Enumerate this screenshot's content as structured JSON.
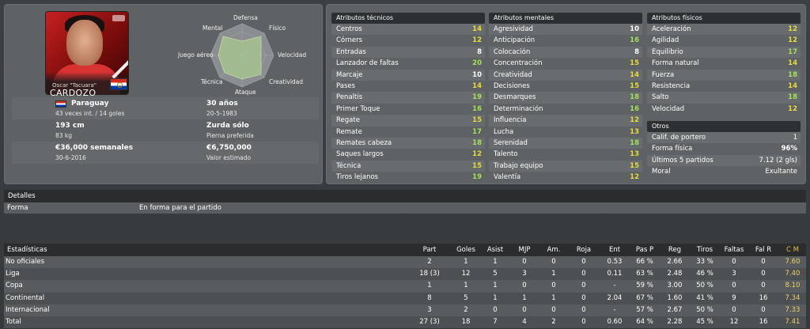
{
  "player": {
    "nickname": "Oscar \"Tacuara\"",
    "surname": "CARDOZO",
    "nationality": "Paraguay",
    "caps": "43 veces int. / 14 goles",
    "age": "30 años",
    "dob": "20-5-1983",
    "height": "193 cm",
    "weight": "83 kg",
    "foot": "Zurda sólo",
    "foot_sub": "Pierna preferida",
    "wage": "€36,000 semanales",
    "contract_end": "30-6-2016",
    "value": "€6,750,000",
    "value_sub": "Valor estimado",
    "flag_colors": [
      "#d52b1e",
      "#ffffff",
      "#0038a8"
    ]
  },
  "radar": {
    "labels": [
      "Defensa",
      "Físico",
      "Velocidad",
      "Creatividad",
      "Ataque",
      "Técnica",
      "Juego aéreo",
      "Mental"
    ]
  },
  "technical": {
    "title": "Atributos técnicos",
    "rows": [
      {
        "name": "Centros",
        "value": "14",
        "color": "yellow"
      },
      {
        "name": "Córners",
        "value": "12",
        "color": "yellow"
      },
      {
        "name": "Entradas",
        "value": "8",
        "color": "white"
      },
      {
        "name": "Lanzador de faltas",
        "value": "20",
        "color": "green"
      },
      {
        "name": "Marcaje",
        "value": "10",
        "color": "white"
      },
      {
        "name": "Pases",
        "value": "14",
        "color": "yellow"
      },
      {
        "name": "Penaltis",
        "value": "19",
        "color": "green"
      },
      {
        "name": "Primer Toque",
        "value": "16",
        "color": "green"
      },
      {
        "name": "Regate",
        "value": "15",
        "color": "yellow"
      },
      {
        "name": "Remate",
        "value": "17",
        "color": "green"
      },
      {
        "name": "Remates cabeza",
        "value": "18",
        "color": "green"
      },
      {
        "name": "Saques largos",
        "value": "12",
        "color": "yellow"
      },
      {
        "name": "Técnica",
        "value": "15",
        "color": "yellow"
      },
      {
        "name": "Tiros lejanos",
        "value": "19",
        "color": "green"
      }
    ]
  },
  "mental": {
    "title": "Atributos mentales",
    "rows": [
      {
        "name": "Agresividad",
        "value": "10",
        "color": "white"
      },
      {
        "name": "Anticipación",
        "value": "16",
        "color": "green"
      },
      {
        "name": "Colocación",
        "value": "8",
        "color": "white"
      },
      {
        "name": "Concentración",
        "value": "15",
        "color": "yellow"
      },
      {
        "name": "Creatividad",
        "value": "14",
        "color": "yellow"
      },
      {
        "name": "Decisiones",
        "value": "15",
        "color": "yellow"
      },
      {
        "name": "Desmarques",
        "value": "18",
        "color": "green"
      },
      {
        "name": "Determinación",
        "value": "16",
        "color": "green"
      },
      {
        "name": "Influencia",
        "value": "12",
        "color": "yellow"
      },
      {
        "name": "Lucha",
        "value": "13",
        "color": "yellow"
      },
      {
        "name": "Serenidad",
        "value": "18",
        "color": "green"
      },
      {
        "name": "Talento",
        "value": "13",
        "color": "yellow"
      },
      {
        "name": "Trabajo equipo",
        "value": "15",
        "color": "yellow"
      },
      {
        "name": "Valentía",
        "value": "12",
        "color": "yellow"
      }
    ]
  },
  "physical": {
    "title": "Atributos físicos",
    "rows": [
      {
        "name": "Aceleración",
        "value": "12",
        "color": "yellow"
      },
      {
        "name": "Agilidad",
        "value": "12",
        "color": "yellow"
      },
      {
        "name": "Equilibrio",
        "value": "17",
        "color": "green"
      },
      {
        "name": "Forma natural",
        "value": "14",
        "color": "yellow"
      },
      {
        "name": "Fuerza",
        "value": "18",
        "color": "green"
      },
      {
        "name": "Resistencia",
        "value": "14",
        "color": "yellow"
      },
      {
        "name": "Salto",
        "value": "18",
        "color": "green"
      },
      {
        "name": "Velocidad",
        "value": "12",
        "color": "yellow"
      }
    ]
  },
  "others": {
    "title": "Otros",
    "rows": [
      {
        "name": "Calif. de portero",
        "value": "1"
      },
      {
        "name": "Forma física",
        "value": "96%"
      },
      {
        "name": "Últimos 5 partidos",
        "value": "7.12 (2 gls)"
      },
      {
        "name": "Moral",
        "value": "Exultante"
      }
    ]
  },
  "details": {
    "title": "Detalles",
    "label": "Forma",
    "value": "En forma para el partido"
  },
  "stats": {
    "title": "Estadísticas",
    "columns": [
      "Part",
      "Goles",
      "Asist",
      "MJP",
      "Am.",
      "Roja",
      "Ent",
      "Pas P",
      "Reg",
      "Tiros",
      "Faltas",
      "Fal R",
      "C M"
    ],
    "rows": [
      {
        "name": "No oficiales",
        "cells": [
          "2",
          "1",
          "1",
          "0",
          "0",
          "0",
          "0.53",
          "66 %",
          "2.66",
          "33 %",
          "0",
          "0",
          "7.60"
        ]
      },
      {
        "name": "Liga",
        "cells": [
          "18 (3)",
          "12",
          "5",
          "3",
          "1",
          "0",
          "0.11",
          "63 %",
          "2.48",
          "46 %",
          "3",
          "0",
          "7.40"
        ]
      },
      {
        "name": "Copa",
        "cells": [
          "1",
          "1",
          "1",
          "0",
          "0",
          "0",
          "-",
          "59 %",
          "3.00",
          "50 %",
          "0",
          "0",
          "8.10"
        ]
      },
      {
        "name": "Continental",
        "cells": [
          "8",
          "5",
          "1",
          "1",
          "1",
          "0",
          "2.04",
          "67 %",
          "1.60",
          "41 %",
          "9",
          "16",
          "7.34"
        ]
      },
      {
        "name": "Internacional",
        "cells": [
          "3",
          "2",
          "0",
          "0",
          "0",
          "0",
          "-",
          "57 %",
          "2.67",
          "50 %",
          "0",
          "0",
          "7.33"
        ]
      },
      {
        "name": "Total",
        "cells": [
          "27 (3)",
          "18",
          "7",
          "4",
          "2",
          "0",
          "0.60",
          "64 %",
          "2.28",
          "45 %",
          "12",
          "16",
          "7.41"
        ]
      }
    ]
  }
}
